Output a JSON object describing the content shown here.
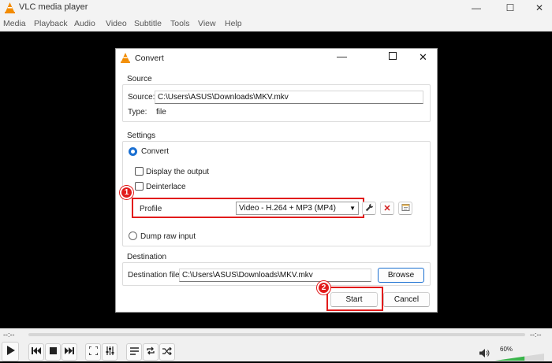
{
  "window": {
    "title": "VLC media player"
  },
  "menu": [
    "Media",
    "Playback",
    "Audio",
    "Video",
    "Subtitle",
    "Tools",
    "View",
    "Help"
  ],
  "dialog": {
    "title": "Convert",
    "source": {
      "group_title": "Source",
      "source_label": "Source:",
      "source_value": "C:\\Users\\ASUS\\Downloads\\MKV.mkv",
      "type_label": "Type:",
      "type_value": "file"
    },
    "settings": {
      "group_title": "Settings",
      "convert_label": "Convert",
      "display_output_label": "Display the output",
      "deinterlace_label": "Deinterlace",
      "profile_label": "Profile",
      "profile_value": "Video - H.264 + MP3 (MP4)",
      "dump_raw_label": "Dump raw input"
    },
    "destination": {
      "group_title": "Destination",
      "file_label": "Destination file:",
      "file_value": "C:\\Users\\ASUS\\Downloads\\MKV.mkv",
      "browse_label": "Browse"
    },
    "start_label": "Start",
    "cancel_label": "Cancel",
    "annotations": {
      "badge1": "1",
      "badge2": "2"
    }
  },
  "player": {
    "elapsed": "--:--",
    "remaining": "--:--",
    "volume": "60%",
    "volume_level": 0.6
  },
  "colors": {
    "accent": "#1a6fd1",
    "annotation": "#e21b1b",
    "vlc_orange": "#f28b00"
  }
}
